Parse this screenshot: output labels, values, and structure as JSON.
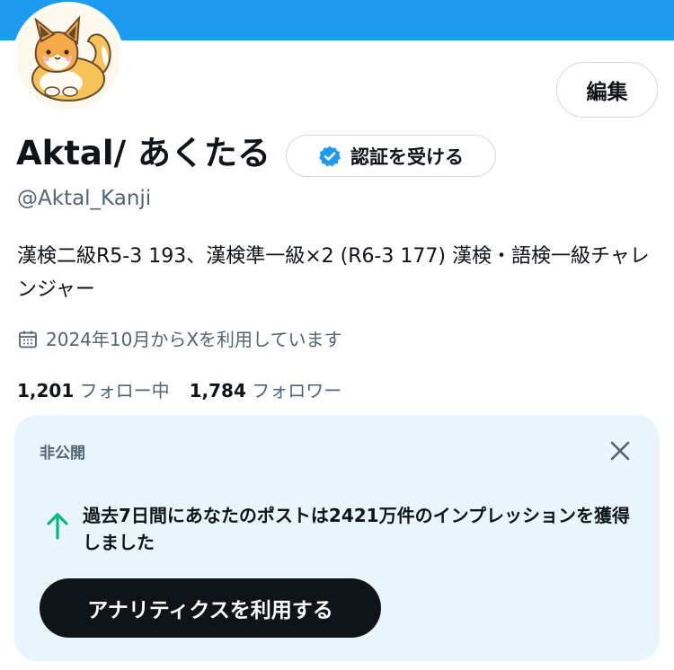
{
  "profile": {
    "display_name": "Aktal/ あくたる",
    "handle": "@Aktal_Kanji",
    "bio": "漢検二級R5-3 193、漢検準一級×2 (R6-3 177) 漢検・語検一級チャレンジャー",
    "joined": "2024年10月からXを利用しています",
    "edit_label": "編集",
    "verify_label": "認証を受ける"
  },
  "stats": {
    "following_count": "1,201",
    "following_label": "フォロー中",
    "followers_count": "1,784",
    "followers_label": "フォロワー"
  },
  "insight_card": {
    "private_label": "非公開",
    "message": "過去7日間にあなたのポストは2421万件のインプレッションを獲得しました",
    "button_label": "アナリティクスを利用する"
  },
  "colors": {
    "banner": "#1d9bf0",
    "card_background": "#e8f5fd",
    "arrow": "#00ba7c",
    "verified_badge": "#1d9bf0",
    "primary_button": "#0f1419"
  },
  "icons": {
    "avatar": "fox-avatar-icon",
    "verify": "verified-badge-icon",
    "joined": "calendar-icon",
    "close": "close-icon",
    "trend": "arrow-up-icon"
  }
}
